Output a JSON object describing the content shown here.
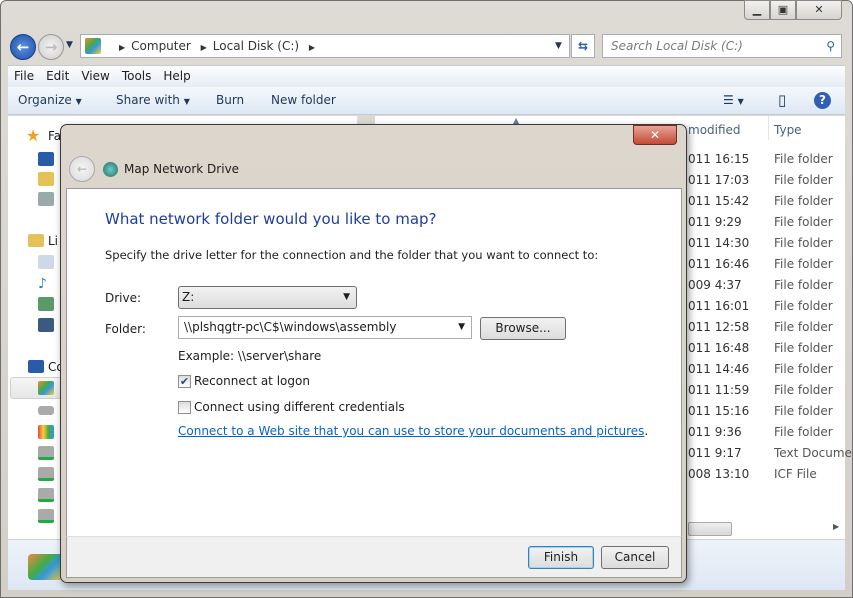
{
  "explorer": {
    "breadcrumb": [
      "Computer",
      "Local Disk (C:)"
    ],
    "search_placeholder": "Search Local Disk (C:)",
    "menu": [
      "File",
      "Edit",
      "View",
      "Tools",
      "Help"
    ],
    "toolbar": {
      "organize": "Organize",
      "share_with": "Share with",
      "burn": "Burn",
      "new_folder": "New folder"
    },
    "nav": {
      "favorites": "Fa",
      "libraries": "Li",
      "computer": "Co"
    },
    "columns": {
      "date_modified": "modified",
      "type": "Type"
    },
    "rows": [
      {
        "date": "011 16:15",
        "type": "File folder"
      },
      {
        "date": "011 17:03",
        "type": "File folder"
      },
      {
        "date": "011 15:42",
        "type": "File folder"
      },
      {
        "date": "011 9:29",
        "type": "File folder"
      },
      {
        "date": "011 14:30",
        "type": "File folder"
      },
      {
        "date": "011 16:46",
        "type": "File folder"
      },
      {
        "date": "009 4:37",
        "type": "File folder"
      },
      {
        "date": "011 16:01",
        "type": "File folder"
      },
      {
        "date": "011 12:58",
        "type": "File folder"
      },
      {
        "date": "011 16:48",
        "type": "File folder"
      },
      {
        "date": "011 14:46",
        "type": "File folder"
      },
      {
        "date": "011 11:59",
        "type": "File folder"
      },
      {
        "date": "011 15:16",
        "type": "File folder"
      },
      {
        "date": "011 9:36",
        "type": "File folder"
      },
      {
        "date": "011 9:17",
        "type": "Text Docume"
      },
      {
        "date": "008 13:10",
        "type": "ICF File"
      }
    ]
  },
  "dialog": {
    "title": "Map Network Drive",
    "heading": "What network folder would you like to map?",
    "instruction": "Specify the drive letter for the connection and the folder that you want to connect to:",
    "drive_label": "Drive:",
    "drive_value": "Z:",
    "folder_label": "Folder:",
    "folder_value": "\\\\plshqgtr-pc\\C$\\windows\\assembly",
    "browse": "Browse...",
    "example": "Example: \\\\server\\share",
    "reconnect": {
      "label": "Reconnect at logon",
      "checked": true
    },
    "credentials": {
      "label": "Connect using different credentials",
      "checked": false
    },
    "link": "Connect to a Web site that you can use to store your documents and pictures",
    "link_suffix": ".",
    "finish": "Finish",
    "cancel": "Cancel"
  },
  "colors": {
    "heading": "#1e3e9e",
    "link": "#0066cc",
    "close": "#c44b36"
  }
}
